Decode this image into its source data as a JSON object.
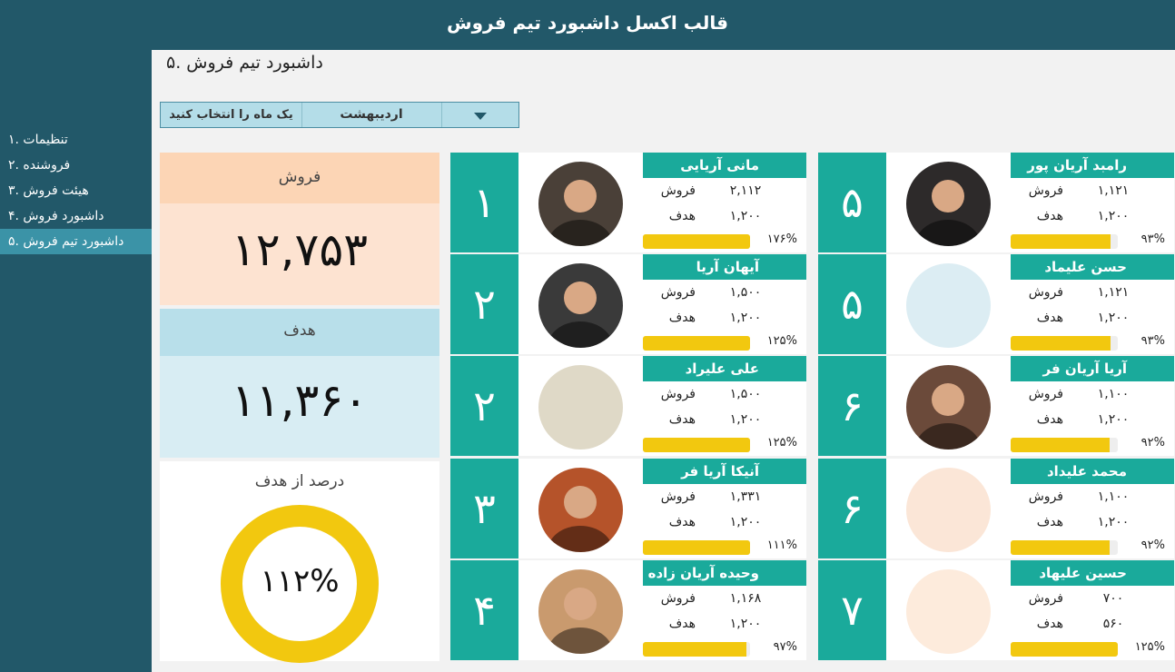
{
  "header": {
    "title": "قالب اکسل داشبورد تیم فروش"
  },
  "nav": [
    {
      "label": "تنظیمات .۱"
    },
    {
      "label": "فروشنده .۲"
    },
    {
      "label": "هیئت فروش .۳"
    },
    {
      "label": "داشبورد فروش .۴"
    },
    {
      "label": "داشبورد تیم فروش .۵"
    }
  ],
  "page": {
    "title": "داشبورد تیم فروش .۵"
  },
  "month_selector": {
    "prompt": "یک ماه را انتخاب کنید",
    "value": "اردیبهشت"
  },
  "kpis": {
    "sales_label": "فروش",
    "sales_value": "۱۲,۷۵۳",
    "target_label": "هدف",
    "target_value": "۱۱,۳۶۰",
    "pct_label": "درصد از هدف",
    "pct_value": "۱۱۲%",
    "pct_fraction": 1.12
  },
  "row_labels": {
    "sales": "فروش",
    "target": "هدف"
  },
  "colors": {
    "dark_teal": "#225869",
    "teal": "#1aaa9b",
    "accent": "#f2c80f",
    "sales_bg": "#fde3d1",
    "target_bg": "#d8edf3"
  },
  "cards_left": [
    {
      "rank": "۱",
      "name": "مانی آریایی",
      "sales": "۲,۱۱۲",
      "target": "۱,۲۰۰",
      "pct": "۱۷۶%",
      "fraction": 1.76,
      "photo": "photo-cowboy-hat",
      "photo_color": "#4a4038"
    },
    {
      "rank": "۲",
      "name": "آیهان آریا",
      "sales": "۱,۵۰۰",
      "target": "۱,۲۰۰",
      "pct": "۱۲۵%",
      "fraction": 1.25,
      "photo": "photo-dark-portrait",
      "photo_color": "#3a3a3a"
    },
    {
      "rank": "۲",
      "name": "علی علیراد",
      "sales": "۱,۵۰۰",
      "target": "۱,۲۰۰",
      "pct": "۱۲۵%",
      "fraction": 1.25,
      "photo": "placeholder",
      "photo_color": "#dfd9c7"
    },
    {
      "rank": "۳",
      "name": "آنیکا آریا فر",
      "sales": "۱,۳۳۱",
      "target": "۱,۲۰۰",
      "pct": "۱۱۱%",
      "fraction": 1.11,
      "photo": "photo-curly-hair",
      "photo_color": "#b5532a"
    },
    {
      "rank": "۴",
      "name": "وحیده آریان زاده",
      "sales": "۱,۱۶۸",
      "target": "۱,۲۰۰",
      "pct": "۹۷%",
      "fraction": 0.97,
      "photo": "photo-blonde",
      "photo_color": "#c99a6e"
    }
  ],
  "cards_right": [
    {
      "rank": "۵",
      "name": "رامبد آریان پور",
      "sales": "۱,۱۲۱",
      "target": "۱,۲۰۰",
      "pct": "۹۳%",
      "fraction": 0.93,
      "photo": "photo-suit",
      "photo_color": "#2d2a2a"
    },
    {
      "rank": "۵",
      "name": "حسن علیماد",
      "sales": "۱,۱۲۱",
      "target": "۱,۲۰۰",
      "pct": "۹۳%",
      "fraction": 0.93,
      "photo": "placeholder",
      "photo_color": "#dcedf3"
    },
    {
      "rank": "۶",
      "name": "آریا آریان فر",
      "sales": "۱,۱۰۰",
      "target": "۱,۲۰۰",
      "pct": "۹۲%",
      "fraction": 0.92,
      "photo": "photo-smiling-man",
      "photo_color": "#6b4a3a"
    },
    {
      "rank": "۶",
      "name": "محمد علیداد",
      "sales": "۱,۱۰۰",
      "target": "۱,۲۰۰",
      "pct": "۹۲%",
      "fraction": 0.92,
      "photo": "placeholder",
      "photo_color": "#fbe6d7"
    },
    {
      "rank": "۷",
      "name": "حسین علیهاد",
      "sales": "۷۰۰",
      "target": "۵۶۰",
      "pct": "۱۲۵%",
      "fraction": 1.25,
      "photo": "placeholder",
      "photo_color": "#fdebdc"
    }
  ]
}
